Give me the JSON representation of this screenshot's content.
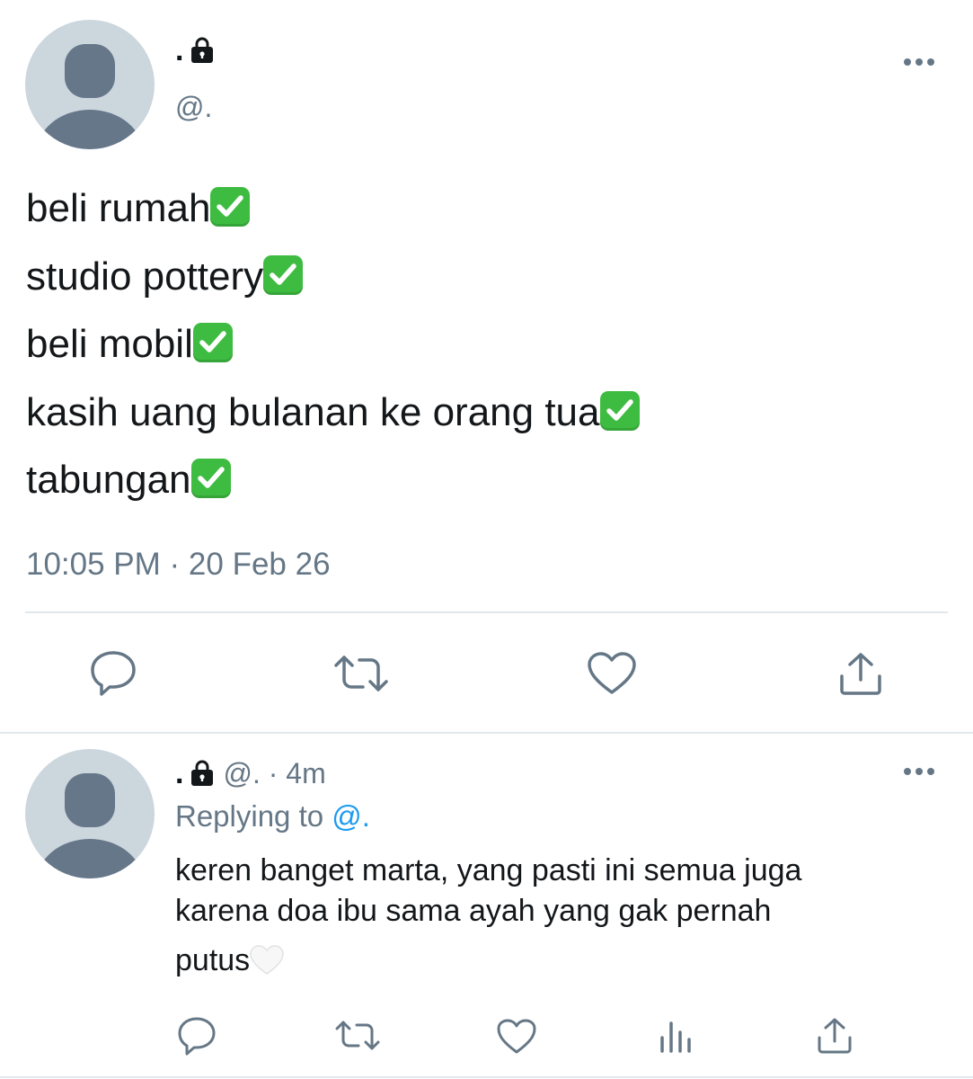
{
  "main_tweet": {
    "display_name": ".",
    "handle": "@.",
    "lines": [
      "beli rumah",
      "studio pottery",
      "beli mobil",
      "kasih uang bulanan ke orang tua",
      "tabungan"
    ],
    "timestamp": "10:05 PM · 20 Feb 26"
  },
  "reply": {
    "display_name": ".",
    "handle_time": "@. · 4m",
    "replying_label": "Replying to",
    "replying_handle": "@.",
    "text_line1": "keren banget marta, yang pasti ini semua juga",
    "text_line2": "karena doa ibu sama ayah yang gak pernah",
    "text_line3": "putus"
  },
  "icons": {
    "lock": "lock-icon",
    "more": "more-icon",
    "reply": "reply-icon",
    "retweet": "retweet-icon",
    "like": "heart-icon",
    "share": "share-icon",
    "analytics": "analytics-icon",
    "check_emoji": "check-mark-button-emoji",
    "white_heart_emoji": "white-heart-emoji"
  },
  "colors": {
    "secondary_text": "#657786",
    "link": "#1d9bf0",
    "check_green": "#3ebc41",
    "avatar_bg": "#ccd6dd",
    "avatar_fg": "#66778a"
  }
}
